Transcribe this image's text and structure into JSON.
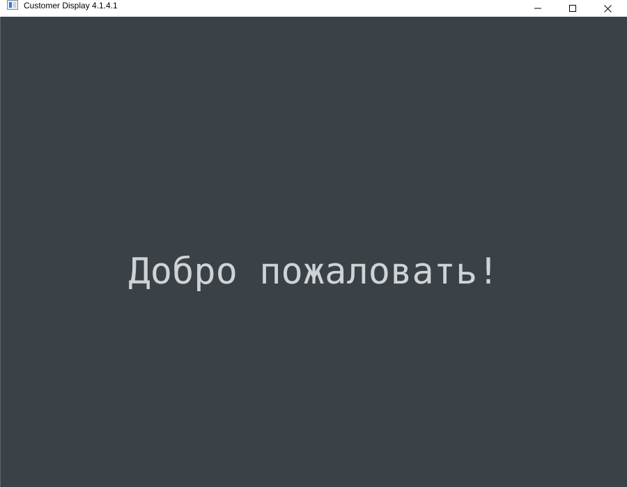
{
  "window": {
    "title": "Customer Display 4.1.4.1",
    "icon": "app-window-icon",
    "controls": {
      "minimize_icon": "minimize-icon",
      "maximize_icon": "maximize-icon",
      "close_icon": "close-icon"
    }
  },
  "display": {
    "message": "Добро пожаловать!",
    "background_color": "#3a4147",
    "text_color": "#cfd3d6"
  }
}
